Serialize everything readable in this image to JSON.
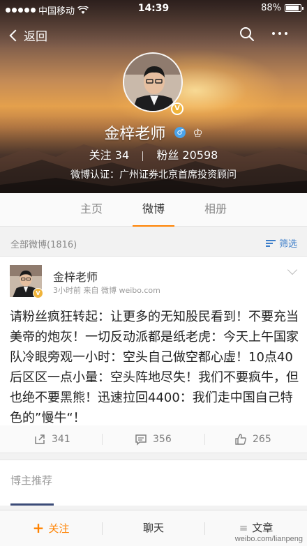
{
  "status_bar": {
    "carrier": "中国移动",
    "time": "14:39",
    "battery_text": "88%",
    "battery_level": 0.88
  },
  "nav": {
    "back_label": "返回",
    "search_icon": "search-icon",
    "more_icon": "more-dots-icon"
  },
  "profile": {
    "name": "金梓老师",
    "follow_label": "关注",
    "follow_count": "34",
    "fans_label": "粉丝",
    "fans_count": "20598",
    "verification": "微博认证：广州证券北京首席投资顾问"
  },
  "tabs": [
    {
      "label": "主页",
      "active": false
    },
    {
      "label": "微博",
      "active": true
    },
    {
      "label": "相册",
      "active": false
    }
  ],
  "filter": {
    "all_label": "全部微博(1816)",
    "filter_label": "筛选"
  },
  "post": {
    "author": "金梓老师",
    "meta": "3小时前  来自 微博 weibo.com",
    "text": "请粉丝疯狂转起：让更多的无知股民看到！不要充当美帝的炮灰！一切反动派都是纸老虎：今天上午国家队冷眼旁观一小时：空头自己做空都心虚！10点40后区区一点小量：空头阵地尽失！我们不要疯牛，但也绝不要黑熊！迅速拉回4400：我们走中国自己特色的”慢牛“！",
    "repost_count": "341",
    "comment_count": "356",
    "like_count": "265"
  },
  "recommend": {
    "title": "博主推荐"
  },
  "bottom_bar": {
    "follow_label": "关注",
    "chat_label": "聊天",
    "article_label": "文章"
  },
  "watermark": "weibo.com/lianpeng",
  "colors": {
    "accent": "#ff8200",
    "link": "#3d7ec9",
    "vip_badge": "#f0b43a"
  }
}
